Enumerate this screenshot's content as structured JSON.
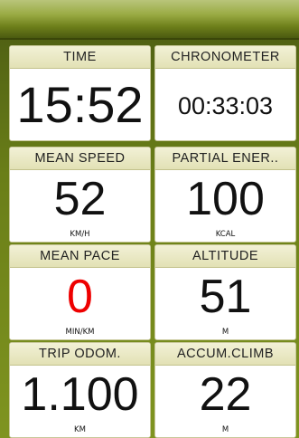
{
  "tiles": {
    "time": {
      "label": "TIME",
      "value": "15:52",
      "unit": ""
    },
    "chronometer": {
      "label": "CHRONOMETER",
      "value": "00:33:03",
      "unit": ""
    },
    "mean_speed": {
      "label": "MEAN SPEED",
      "value": "52",
      "unit": "KM/H"
    },
    "partial_energy": {
      "label": "PARTIAL ENER..",
      "value": "100",
      "unit": "KCAL"
    },
    "mean_pace": {
      "label": "MEAN PACE",
      "value": "0",
      "unit": "MIN/KM"
    },
    "altitude": {
      "label": "ALTITUDE",
      "value": "51",
      "unit": "M"
    },
    "trip_odometer": {
      "label": "TRIP ODOM.",
      "value": "1.100",
      "unit": "KM"
    },
    "accum_climb": {
      "label": "ACCUM.CLIMB",
      "value": "22",
      "unit": "M"
    }
  },
  "colors": {
    "frame_green": "#6a7e18",
    "header_cream": "#ecebc8",
    "alert_red": "#ee0000"
  }
}
